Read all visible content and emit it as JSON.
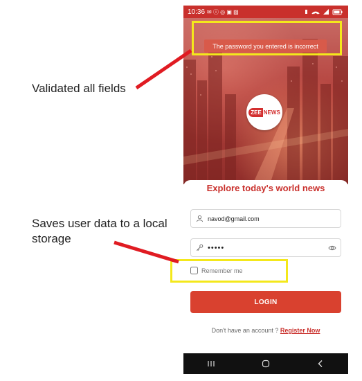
{
  "annotations": {
    "validated_label": "Validated all fields",
    "saves_label_line1": "Saves user data to a local",
    "saves_label_line2": "storage"
  },
  "status_bar": {
    "time": "10:36"
  },
  "toast": {
    "message": "The password you entered is incorrect"
  },
  "logo": {
    "part1": "ZEE",
    "part2": "NEWS"
  },
  "form": {
    "headline": "Explore today's world news",
    "email_value": "navod@gmail.com",
    "password_value": "•••••",
    "remember_label": "Remember me",
    "login_label": "LOGIN",
    "signup_prompt": "Don't have an account ? ",
    "signup_link": "Register Now"
  },
  "colors": {
    "brand": "#c9302c",
    "button": "#d9412f",
    "highlight": "#f4e81b",
    "arrow": "#e01b22"
  },
  "icons": [
    "person-icon",
    "key-icon",
    "eye-icon",
    "recent-apps-icon",
    "home-icon",
    "back-icon"
  ]
}
